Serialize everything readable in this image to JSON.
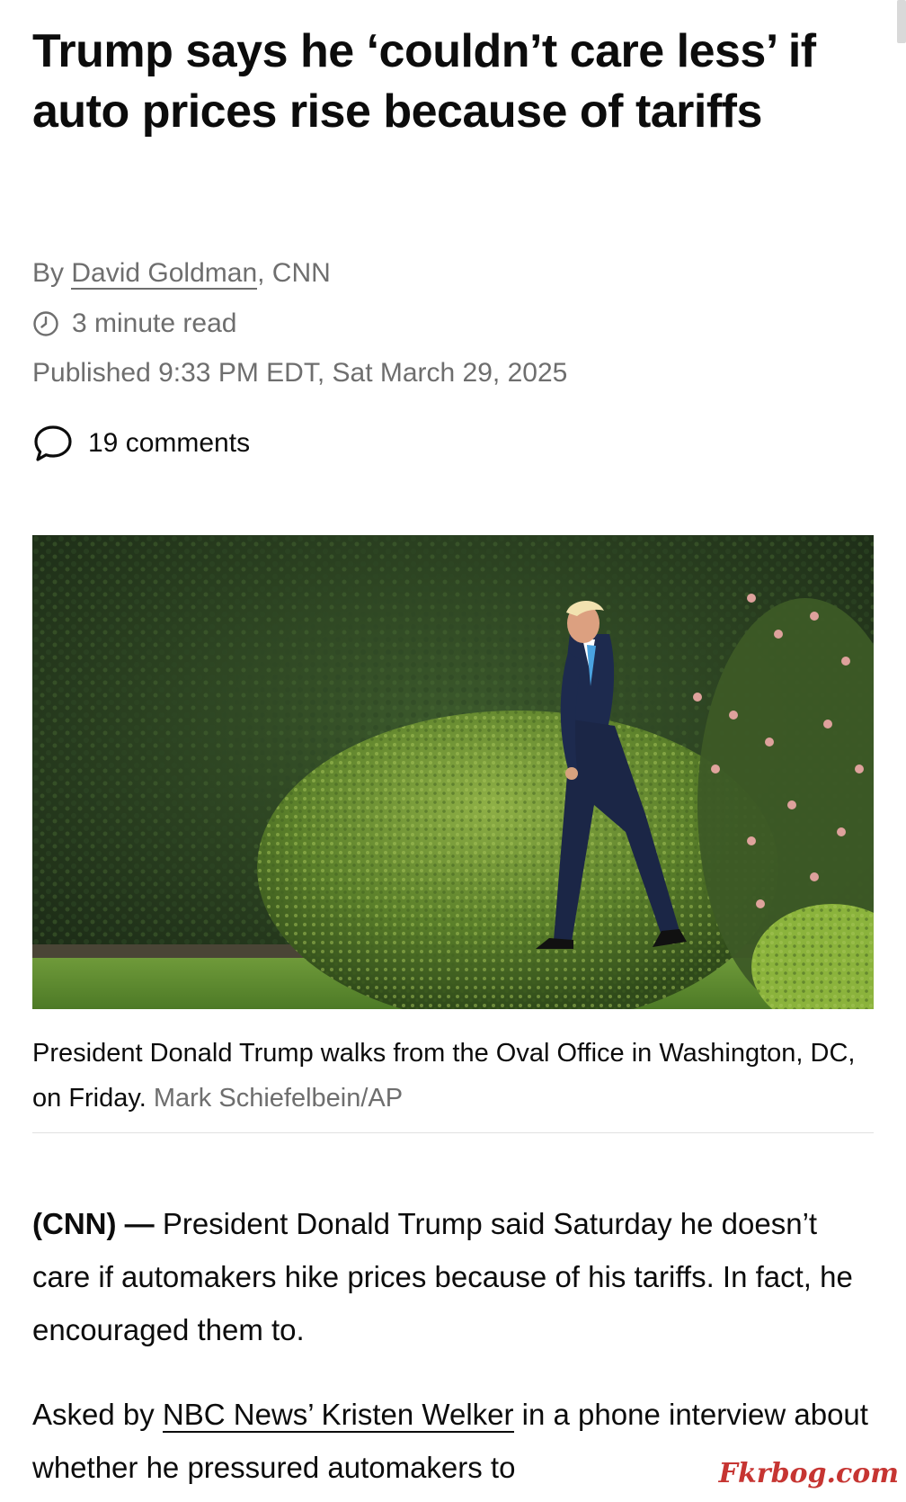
{
  "article": {
    "headline": "Trump says he ‘couldn’t care less’ if auto prices rise because of tariffs",
    "byline": {
      "prefix": "By ",
      "author": "David Goldman",
      "suffix": ", CNN"
    },
    "read_time": "3 minute read",
    "published": "Published 9:33 PM EDT, Sat March 29, 2025",
    "comments_label": "19 comments",
    "photo": {
      "caption": "President Donald Trump walks from the Oval Office in Washington, DC, on Friday.",
      "credit": "Mark Schiefelbein/AP"
    },
    "paragraphs": [
      {
        "lead": "(CNN) —",
        "text": " President Donald Trump said Saturday he doesn’t care if automakers hike prices because of his tariffs. In fact, he encouraged them to."
      },
      {
        "before": "Asked by ",
        "link": "NBC News’ Kristen Welker",
        "after": " in a phone interview about whether he pressured automakers to"
      }
    ]
  },
  "icons": {
    "clock": "clock-icon",
    "comment": "speech-bubble-icon"
  },
  "watermark": "Fkrbog.com",
  "colors": {
    "text": "#0c0c0c",
    "meta": "#6e6e6e",
    "divider": "#e1e1e1",
    "watermark": "#c0201c"
  }
}
